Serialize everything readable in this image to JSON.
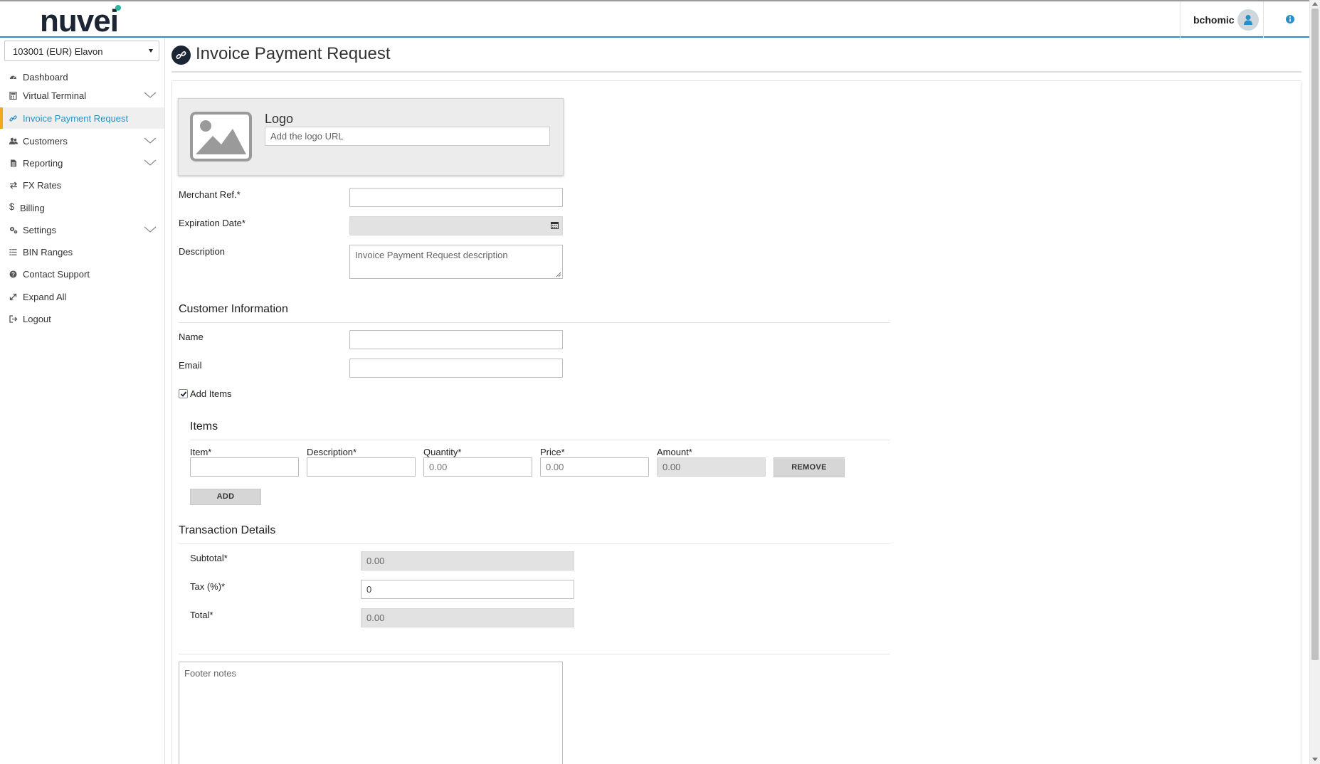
{
  "header": {
    "brand": "nuvei",
    "username": "bchomic"
  },
  "sidebar": {
    "account": "103001 (EUR) Elavon",
    "items": [
      {
        "label": "Dashboard",
        "icon": "dashboard-icon"
      },
      {
        "label": "Virtual Terminal",
        "icon": "calculator-icon"
      },
      {
        "label": "Invoice Payment Request",
        "icon": "link-icon"
      },
      {
        "label": "Customers",
        "icon": "users-icon"
      },
      {
        "label": "Reporting",
        "icon": "file-icon"
      },
      {
        "label": "FX Rates",
        "icon": "exchange-icon"
      },
      {
        "label": "Billing",
        "icon": "dollar-icon"
      },
      {
        "label": "Settings",
        "icon": "cogs-icon"
      },
      {
        "label": "BIN Ranges",
        "icon": "list-icon"
      },
      {
        "label": "Contact Support",
        "icon": "question-icon"
      },
      {
        "label": "Expand All",
        "icon": "expand-icon"
      },
      {
        "label": "Logout",
        "icon": "sign-out-icon"
      }
    ]
  },
  "page": {
    "title": "Invoice Payment Request"
  },
  "logo_card": {
    "label": "Logo",
    "placeholder": "Add the logo URL"
  },
  "form": {
    "merchant_ref_label": "Merchant Ref.*",
    "expiration_label": "Expiration Date*",
    "description_label": "Description",
    "description_placeholder": "Invoice Payment Request description"
  },
  "customer": {
    "title": "Customer Information",
    "name_label": "Name",
    "email_label": "Email",
    "add_items_label": "Add Items"
  },
  "items": {
    "title": "Items",
    "col_item": "Item*",
    "col_description": "Description*",
    "col_quantity": "Quantity*",
    "col_price": "Price*",
    "col_amount": "Amount*",
    "quantity_placeholder": "0.00",
    "price_placeholder": "0.00",
    "amount_value": "0.00",
    "remove_label": "REMOVE",
    "add_label": "ADD"
  },
  "transaction": {
    "title": "Transaction Details",
    "subtotal_label": "Subtotal*",
    "subtotal_value": "0.00",
    "tax_label": "Tax (%)*",
    "tax_value": "0",
    "total_label": "Total*",
    "total_value": "0.00"
  },
  "footer": {
    "placeholder": "Footer notes"
  },
  "colors": {
    "accent": "#2a8fc9",
    "active_marker": "#f3a71f",
    "brand_dark": "#1b2533",
    "brand_dot": "#2bb5a0"
  }
}
